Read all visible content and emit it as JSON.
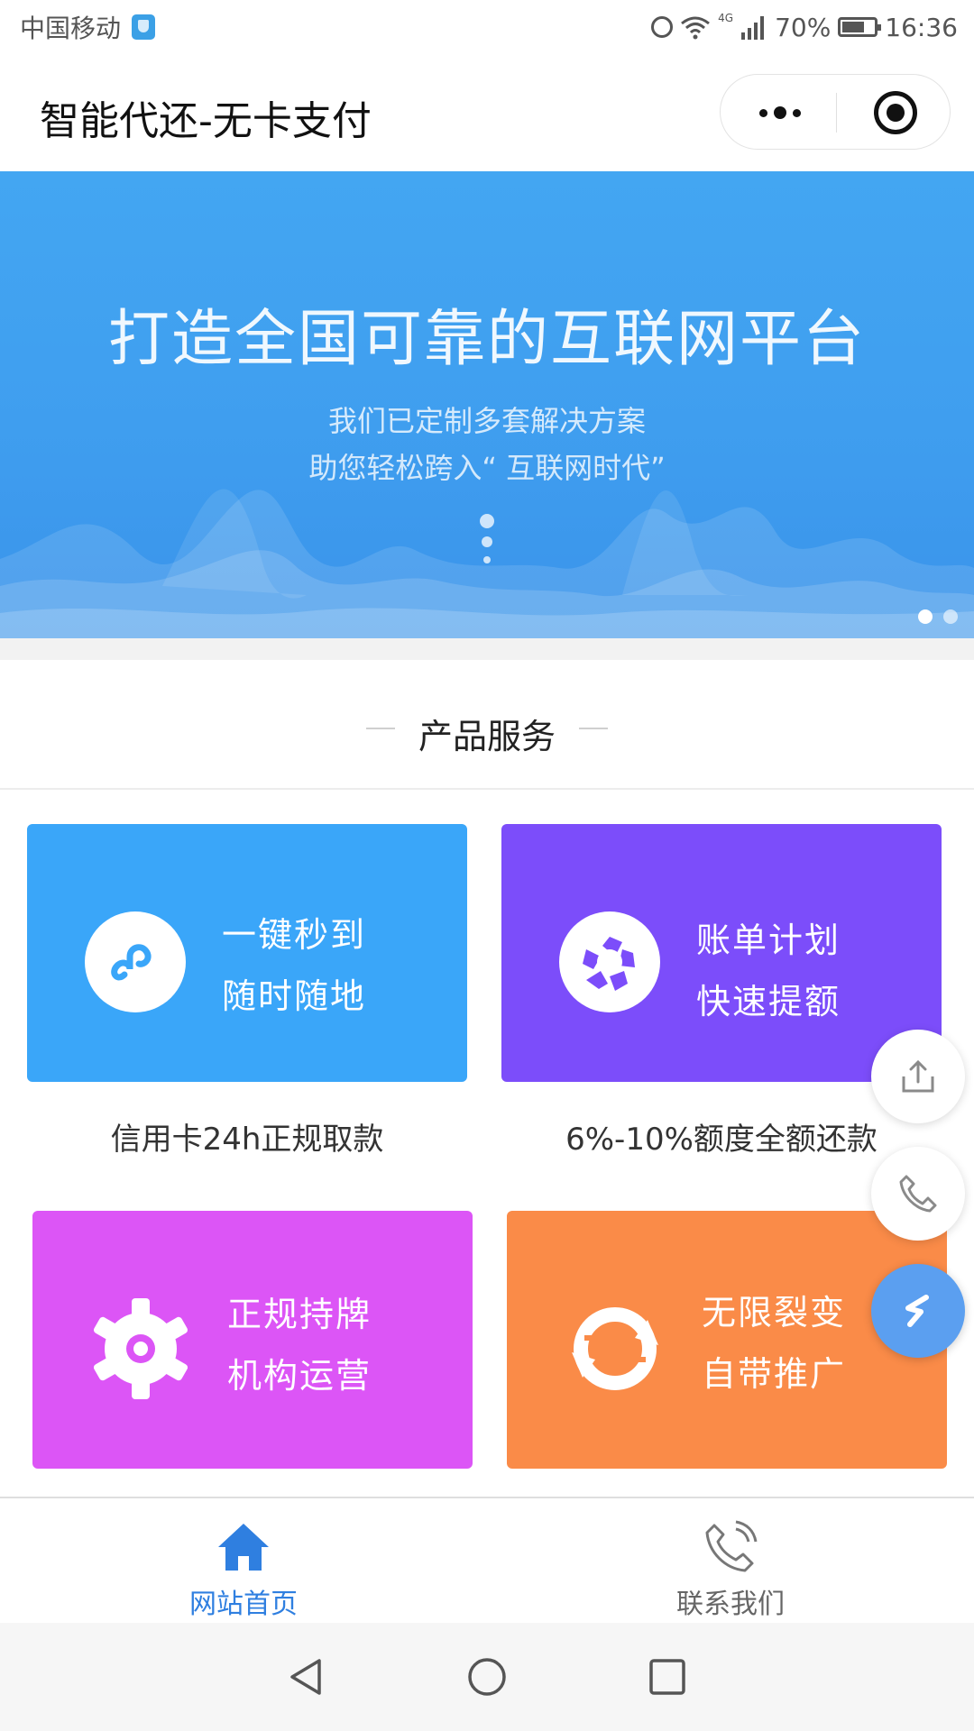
{
  "status_bar": {
    "carrier": "中国移动",
    "network": "4G",
    "battery": "70%",
    "battery_level": 0.7,
    "time": "16:36",
    "icons": [
      "shield-icon",
      "alarm-icon",
      "wifi-icon",
      "signal-icon",
      "battery-icon"
    ]
  },
  "header": {
    "title": "智能代还-无卡支付",
    "icons": [
      "more-dots-icon",
      "close-target-icon"
    ]
  },
  "banner": {
    "headline": "打造全国可靠的互联网平台",
    "subtitle_line1": "我们已定制多套解决方案",
    "subtitle_line2": "助您轻松跨入“ 互联网时代”",
    "slide_count": 2,
    "active_slide": 1
  },
  "section": {
    "title": "产品服务"
  },
  "services": [
    {
      "line1": "一键秒到",
      "line2": "随时随地",
      "caption": "信用卡24h正规取款",
      "color": "#3aa6f9",
      "icon": "link-icon"
    },
    {
      "line1": "账单计划",
      "line2": "快速提额",
      "caption": "6%-10%额度全额还款",
      "color": "#7c4dfa",
      "icon": "aperture-icon"
    },
    {
      "line1": "正规持牌",
      "line2": "机构运营",
      "caption": "",
      "color": "#dc55f6",
      "icon": "gear-icon"
    },
    {
      "line1": "无限裂变",
      "line2": "自带推广",
      "caption": "",
      "color": "#fa8b48",
      "icon": "refresh-icon"
    }
  ],
  "floating_buttons": [
    "share-icon",
    "phone-icon",
    "brand-logo-icon"
  ],
  "tabs": [
    {
      "label": "网站首页",
      "icon": "home-icon",
      "active": true,
      "color": "#2f7fe0"
    },
    {
      "label": "联系我们",
      "icon": "phone-call-icon",
      "active": false,
      "color": "#666666"
    }
  ],
  "system_nav": [
    "back-icon",
    "home-circle-icon",
    "recents-icon"
  ]
}
